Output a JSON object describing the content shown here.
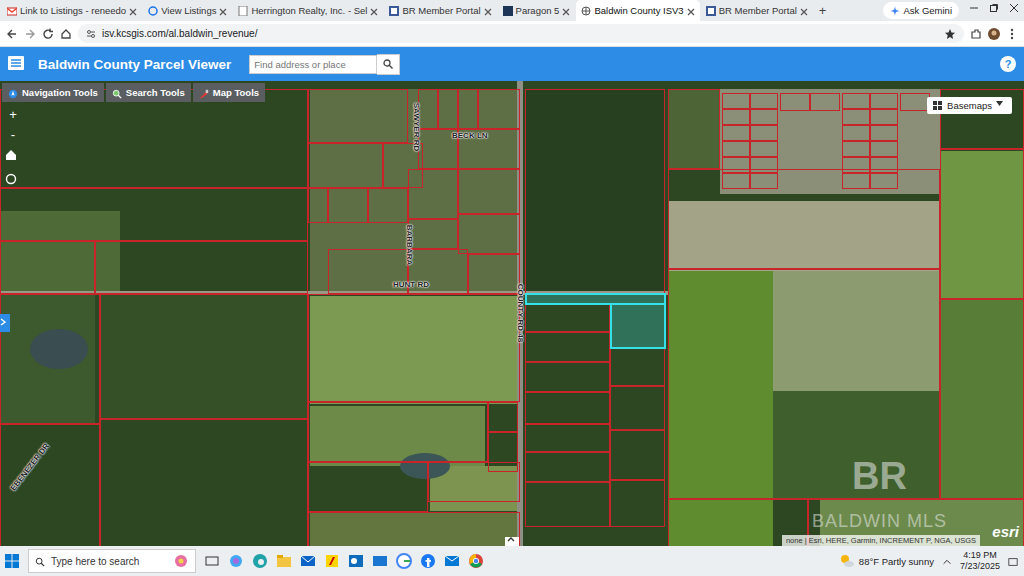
{
  "browser": {
    "tabs": [
      {
        "label": "Link to Listings - reneedo",
        "selected": false
      },
      {
        "label": "View Listings",
        "selected": false
      },
      {
        "label": "Herrington Realty, Inc. - Sel",
        "selected": false
      },
      {
        "label": "BR Member Portal",
        "selected": false
      },
      {
        "label": "Paragon 5",
        "selected": false
      },
      {
        "label": "Baldwin County ISV3",
        "selected": true
      },
      {
        "label": "BR Member Portal",
        "selected": false
      }
    ],
    "new_tab": "+",
    "ask_gemini": "Ask Gemini",
    "address": "isv.kcsgis.com/al.baldwin_revenue/"
  },
  "app": {
    "title": "Baldwin County Parcel Viewer",
    "search": {
      "placeholder": "Find address or place"
    },
    "help": "?"
  },
  "tools": [
    {
      "label": "Navigation Tools"
    },
    {
      "label": "Search Tools"
    },
    {
      "label": "Map Tools"
    }
  ],
  "basemaps": "Basemaps",
  "map": {
    "zoom_in": "+",
    "zoom_out": "-",
    "roads": [
      "SAWYER RD",
      "BECK LN",
      "BARBARA",
      "HUNT RD",
      "COUNTY RD 48",
      "EBENEZER DR"
    ],
    "parcel_selected": true,
    "attribution": "none | Esri, HERE, Garmin, INCREMENT P, NGA, USGS",
    "esri": "esri",
    "watermark": {
      "logo": "BR",
      "text": "BALDWIN MLS"
    }
  },
  "taskbar": {
    "search_placeholder": "Type here to search",
    "weather": "88°F Partly sunny",
    "time": "4:19 PM",
    "date": "7/23/2025"
  }
}
